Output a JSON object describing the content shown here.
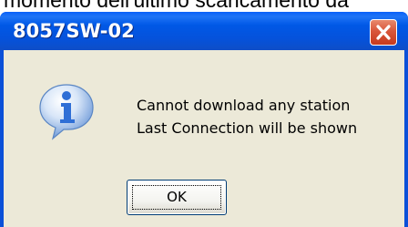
{
  "background": {
    "partial_text": "momento dell'ultimo scaricamento da"
  },
  "dialog": {
    "title": "8057SW-02",
    "message_line1": "Cannot download any station",
    "message_line2": "Last Connection will be shown",
    "ok_label": "OK",
    "icon": "info-icon",
    "close_icon": "close-icon"
  },
  "colors": {
    "titlebar": "#0058e6",
    "client": "#ece9d8",
    "close_button": "#d9563a",
    "icon_blue": "#2f6fd6"
  }
}
